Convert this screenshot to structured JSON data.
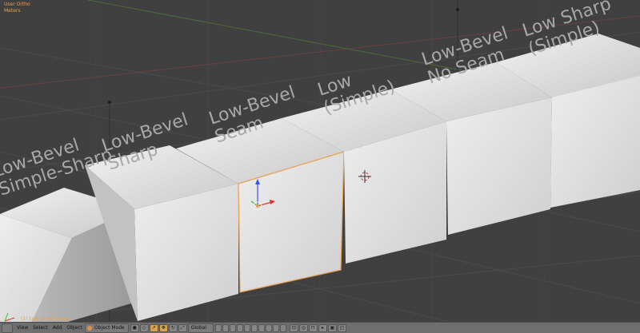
{
  "app": "Blender 3D Viewport",
  "viewport": {
    "view_name": "User Ortho",
    "units": "Meters",
    "active_object": "(1) Low-Bevel_Seam"
  },
  "cube_labels": [
    {
      "line1": "Low-Bevel",
      "line2": "Simple-Sharp"
    },
    {
      "line1": "Low-Bevel",
      "line2": "Sharp"
    },
    {
      "line1": "Low-Bevel",
      "line2": "Seam"
    },
    {
      "line1": "Low",
      "line2": "(Simple)"
    },
    {
      "line1": "Low-Bevel",
      "line2": "No Seam"
    },
    {
      "line1": "Low Sharp",
      "line2": "(Simple)"
    }
  ],
  "header": {
    "menus": [
      "View",
      "Select",
      "Add",
      "Object"
    ],
    "mode": "Object Mode",
    "orientation": "Global"
  },
  "colors": {
    "grid_bg": "#404040",
    "selection_outline": "#e8a050",
    "cube_face": "#dcdcdc",
    "label_text": "#a8a8a8"
  },
  "icons": [
    "editor-type-icon",
    "object-mode-icon",
    "viewport-shading-icon",
    "pivot-icon",
    "manipulator-icon",
    "layers-icon",
    "snap-icon",
    "render-icon"
  ]
}
